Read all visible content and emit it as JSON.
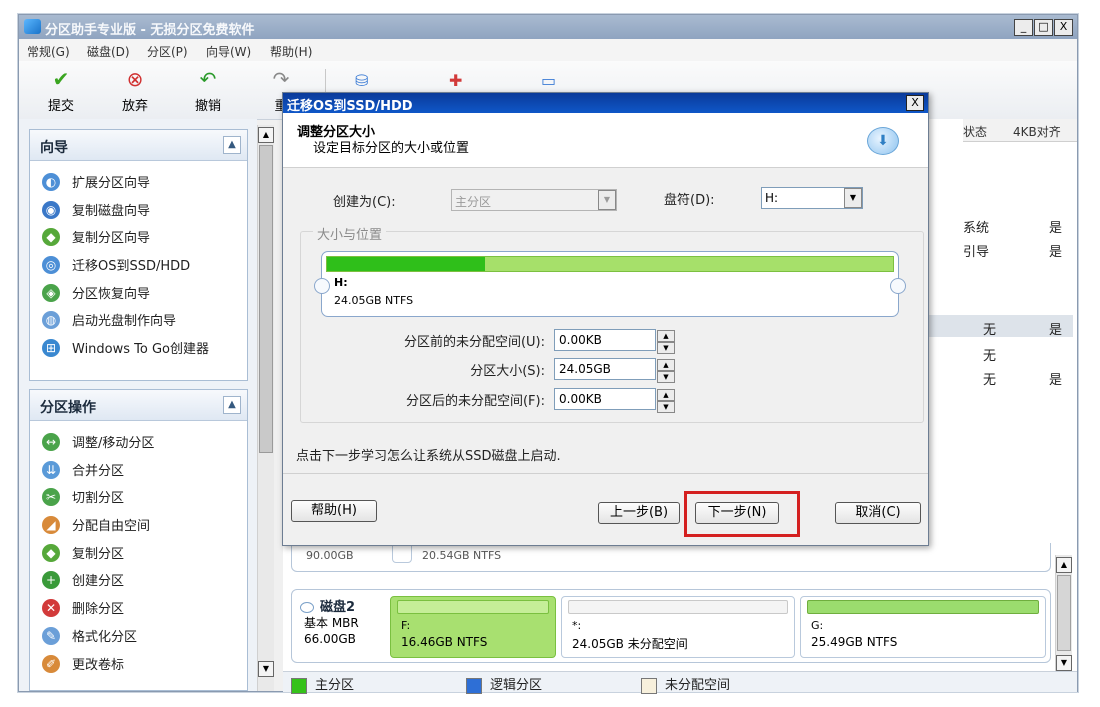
{
  "window": {
    "title": "分区助手专业版 - 无损分区免费软件",
    "minimize": "_",
    "maximize": "□",
    "close": "X"
  },
  "menu": [
    "常规(G)",
    "磁盘(D)",
    "分区(P)",
    "向导(W)",
    "帮助(H)"
  ],
  "toolbar": {
    "commit": "提交",
    "discard": "放弃",
    "undo": "撤销",
    "redo": "重"
  },
  "sidebar": {
    "wizard_title": "向导",
    "wizard_items": [
      "扩展分区向导",
      "复制磁盘向导",
      "复制分区向导",
      "迁移OS到SSD/HDD",
      "分区恢复向导",
      "启动光盘制作向导",
      "Windows To Go创建器"
    ],
    "ops_title": "分区操作",
    "ops_items": [
      "调整/移动分区",
      "合并分区",
      "切割分区",
      "分配自由空间",
      "复制分区",
      "创建分区",
      "删除分区",
      "格式化分区",
      "更改卷标"
    ]
  },
  "table": {
    "col_status": "状态",
    "col_4k": "4KB对齐",
    "rows": [
      {
        "status": "系统",
        "align": "是"
      },
      {
        "status": "引导",
        "align": "是"
      },
      {
        "status": "无",
        "align": "是"
      },
      {
        "status": "无",
        "align": ""
      },
      {
        "status": "无",
        "align": "是"
      }
    ]
  },
  "dialog": {
    "title": "迁移OS到SSD/HDD",
    "close": "X",
    "header_title": "调整分区大小",
    "header_sub": "设定目标分区的大小或位置",
    "create_as_label": "创建为(C):",
    "create_as_value": "主分区",
    "drive_letter_label": "盘符(D):",
    "drive_letter_value": "H:",
    "group_label": "大小与位置",
    "partition_name": "H:",
    "partition_info": "24.05GB NTFS",
    "partition_fill_percent": 28,
    "before_label": "分区前的未分配空间(U):",
    "before_value": "0.00KB",
    "size_label": "分区大小(S):",
    "size_value": "24.05GB",
    "after_label": "分区后的未分配空间(F):",
    "after_value": "0.00KB",
    "hint": "点击下一步学习怎么让系统从SSD磁盘上启动.",
    "help_button": "帮助(H)",
    "back_button": "上一步(B)",
    "next_button": "下一步(N)",
    "cancel_button": "取消(C)"
  },
  "disk1_partial": {
    "left_text": "90.00GB",
    "right_text": "20.54GB NTFS"
  },
  "disk2": {
    "name": "磁盘2",
    "type": "基本 MBR",
    "size": "66.00GB",
    "partitions": [
      {
        "label": "F:",
        "info": "16.46GB NTFS"
      },
      {
        "label": "*:",
        "info": "24.05GB 未分配空间"
      },
      {
        "label": "G:",
        "info": "25.49GB NTFS"
      }
    ]
  },
  "legend": {
    "primary": "主分区",
    "logical": "逻辑分区",
    "unallocated": "未分配空间"
  },
  "colors": {
    "highlight_box": "#d42020",
    "primary": "#35c21a",
    "logical": "#2e6fd6",
    "unallocated": "#f7f0dc",
    "selected_partition": "#a8e070"
  }
}
